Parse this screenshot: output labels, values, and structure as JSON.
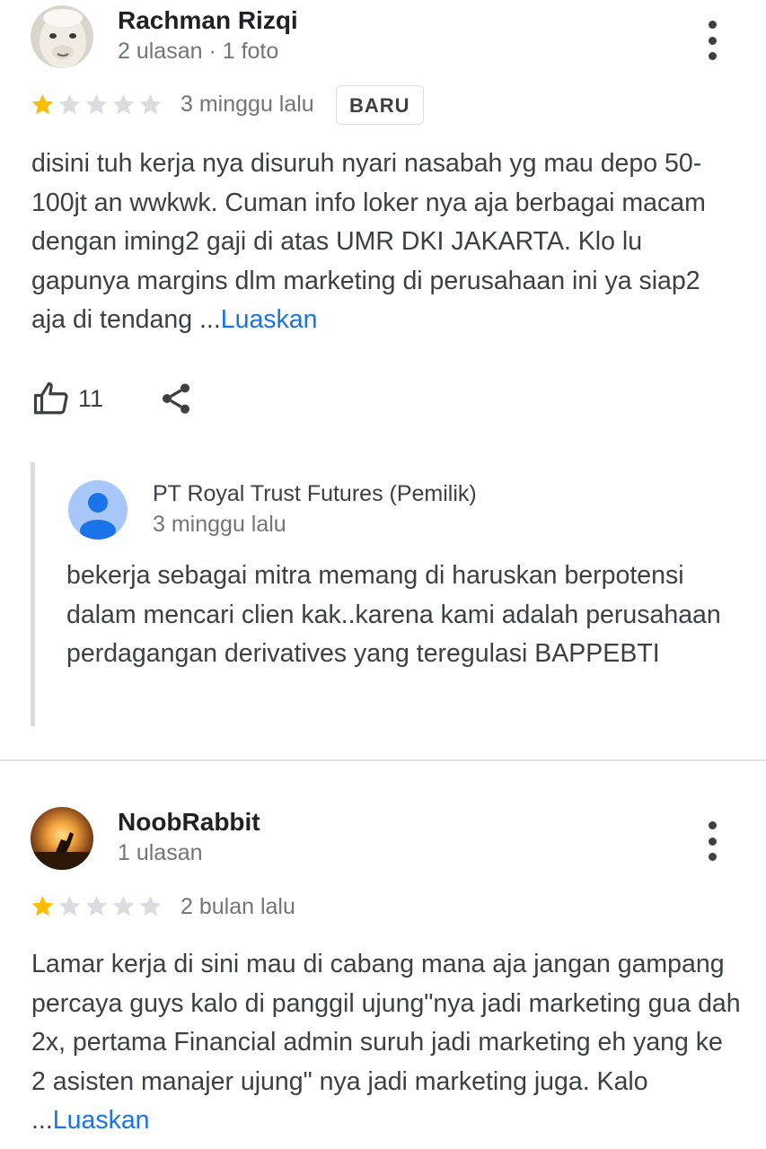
{
  "reviews": [
    {
      "author": "Rachman Rizqi",
      "meta": "2 ulasan · 1 foto",
      "rating": 1,
      "rating_max": 5,
      "time": "3 minggu lalu",
      "badge": "BARU",
      "text": "disini tuh kerja nya disuruh nyari nasabah yg mau depo 50-100jt an wwkwk. Cuman info loker nya aja berbagai macam dengan iming2 gaji di atas UMR DKI JAKARTA. Klo lu gapunya margins dlm marketing di perusahaan ini ya siap2 aja di tendang ...",
      "more_label": "Luaskan",
      "likes": "11",
      "owner_reply": {
        "name": "PT Royal Trust Futures (Pemilik)",
        "time": "3 minggu lalu",
        "text": "bekerja sebagai mitra memang di haruskan berpotensi dalam mencari clien kak..karena kami adalah perusahaan perdagangan derivatives yang teregulasi BAPPEBTI"
      }
    },
    {
      "author": "NoobRabbit",
      "meta": "1 ulasan",
      "rating": 1,
      "rating_max": 5,
      "time": "2 bulan lalu",
      "text": "Lamar kerja di sini mau di cabang mana aja jangan gampang percaya guys kalo di panggil ujung\"nya jadi marketing gua dah 2x, pertama Financial admin suruh jadi marketing eh yang ke 2 asisten manajer ujung\" nya jadi marketing juga. Kalo ...",
      "more_label": "Luaskan"
    }
  ],
  "colors": {
    "star_filled": "#fbbc04",
    "star_empty": "#dadce0",
    "link": "#1a73e8",
    "owner_avatar": "#a8c7fa"
  },
  "icons": {
    "like": "thumb-up-outline-icon",
    "share": "share-icon",
    "menu": "more-vert-icon"
  }
}
